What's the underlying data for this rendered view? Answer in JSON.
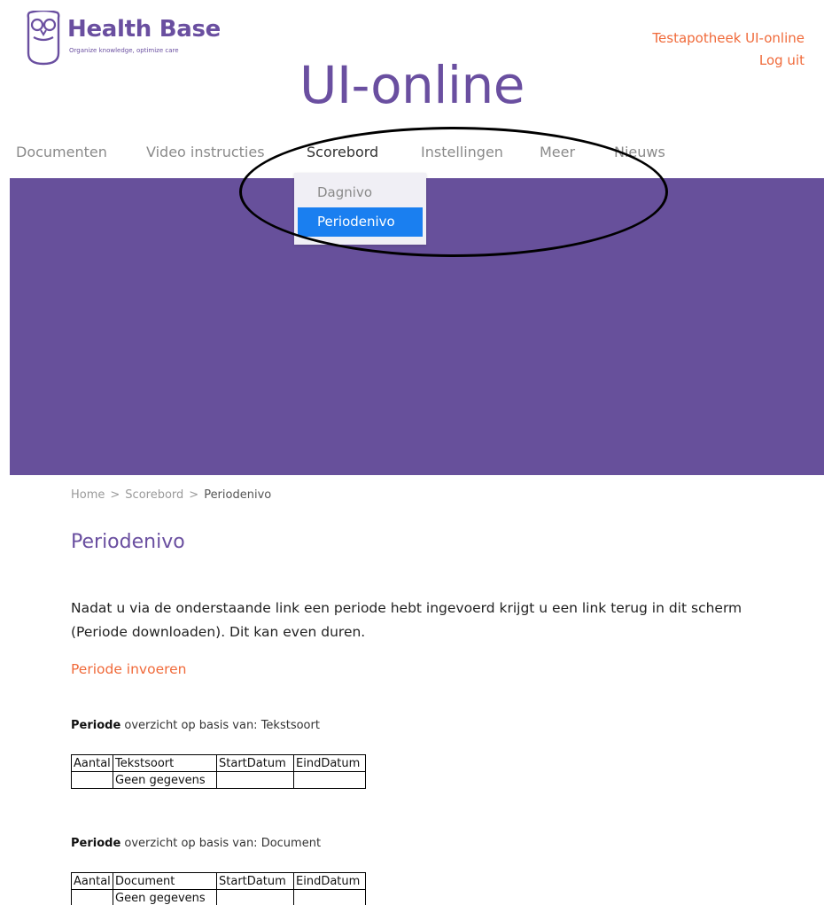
{
  "brand": {
    "name": "Health Base",
    "tagline": "Organize knowledge, optimize care"
  },
  "header": {
    "account_link": "Testapotheek UI-online",
    "logout_link": "Log uit"
  },
  "app_title": "UI-online",
  "nav": {
    "items": [
      {
        "label": "Documenten"
      },
      {
        "label": "Video instructies"
      },
      {
        "label": "Scorebord"
      },
      {
        "label": "Instellingen"
      },
      {
        "label": "Meer"
      },
      {
        "label": "Nieuws"
      }
    ],
    "active": "Scorebord",
    "dropdown": {
      "items": [
        {
          "label": "Dagnivo"
        },
        {
          "label": "Periodenivo"
        }
      ],
      "selected": "Periodenivo"
    }
  },
  "breadcrumb": {
    "home": "Home",
    "separator": ">",
    "section": "Scorebord",
    "current": "Periodenivo"
  },
  "main": {
    "heading": "Periodenivo",
    "intro": "Nadat u via de onderstaande link een periode hebt ingevoerd krijgt u een link terug in dit scherm (Periode downloaden). Dit kan even duren.",
    "action_link": "Periode invoeren",
    "tables": [
      {
        "caption_bold": "Periode",
        "caption_rest": " overzicht op basis van: Tekstsoort",
        "columns": [
          "Aantal",
          "Tekstsoort",
          "StartDatum",
          "EindDatum"
        ],
        "rows": [
          [
            "",
            "Geen gegevens",
            "",
            ""
          ]
        ]
      },
      {
        "caption_bold": "Periode",
        "caption_rest": " overzicht op basis van: Document",
        "columns": [
          "Aantal",
          "Document",
          "StartDatum",
          "EindDatum"
        ],
        "rows": [
          [
            "",
            "Geen gegevens",
            "",
            ""
          ]
        ]
      }
    ]
  },
  "colors": {
    "brand_purple": "#6a4fa0",
    "banner_purple": "#67509b",
    "link_orange": "#f06a3a",
    "selected_blue": "#1a7ff0"
  }
}
